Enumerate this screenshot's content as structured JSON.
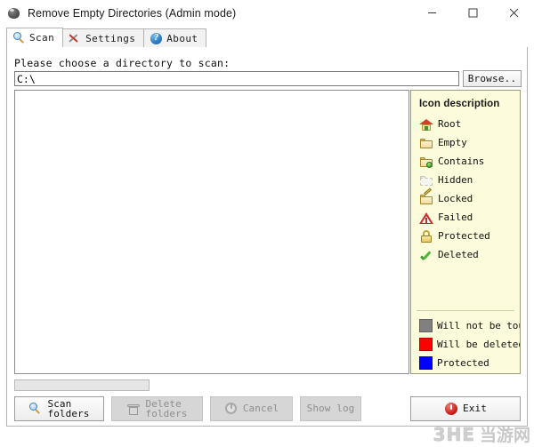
{
  "window": {
    "title": "Remove Empty Directories (Admin mode)",
    "icon": "app-disc-icon",
    "controls": {
      "minimize": "minimize-icon",
      "maximize": "maximize-icon",
      "close": "close-icon"
    }
  },
  "tabs": [
    {
      "label": "Scan",
      "icon": "magnifier-icon",
      "active": true
    },
    {
      "label": "Settings",
      "icon": "tools-icon",
      "active": false
    },
    {
      "label": "About",
      "icon": "question-circle-icon",
      "active": false
    }
  ],
  "scan_panel": {
    "directory_label": "Please choose a directory to scan:",
    "directory_value": "C:\\",
    "directory_placeholder": "C:\\",
    "browse_label": "Browse..",
    "tree_items": [],
    "progress_value": 0
  },
  "legend": {
    "title": "Icon description",
    "icons": [
      {
        "icon": "house-root-icon",
        "label": "Root"
      },
      {
        "icon": "folder-empty-icon",
        "label": "Empty"
      },
      {
        "icon": "folder-contains-icon",
        "label": "Contains"
      },
      {
        "icon": "folder-hidden-icon",
        "label": "Hidden"
      },
      {
        "icon": "folder-locked-icon",
        "label": "Locked"
      },
      {
        "icon": "warning-triangle-icon",
        "label": "Failed"
      },
      {
        "icon": "padlock-icon",
        "label": "Protected"
      },
      {
        "icon": "green-check-icon",
        "label": "Deleted"
      }
    ],
    "colors": [
      {
        "swatch": "gray-swatch",
        "color": "#808080",
        "label": "Will not be touched"
      },
      {
        "swatch": "red-swatch",
        "color": "#FF0000",
        "label": "Will be deleted"
      },
      {
        "swatch": "blue-swatch",
        "color": "#0000FF",
        "label": "Protected"
      }
    ]
  },
  "buttons": [
    {
      "id": "scan",
      "icon": "magnifier-icon",
      "label": "Scan\nfolders",
      "disabled": false
    },
    {
      "id": "delete",
      "icon": "trash-icon",
      "label": "Delete\nfolders",
      "disabled": true
    },
    {
      "id": "cancel",
      "icon": "cancel-icon",
      "label": "Cancel",
      "disabled": true
    },
    {
      "id": "log",
      "icon": "",
      "label": "Show log",
      "disabled": true
    },
    {
      "id": "exit",
      "icon": "power-icon",
      "label": "Exit",
      "disabled": false
    }
  ],
  "watermark": {
    "latin": "3HE",
    "cjk": "当游网"
  }
}
